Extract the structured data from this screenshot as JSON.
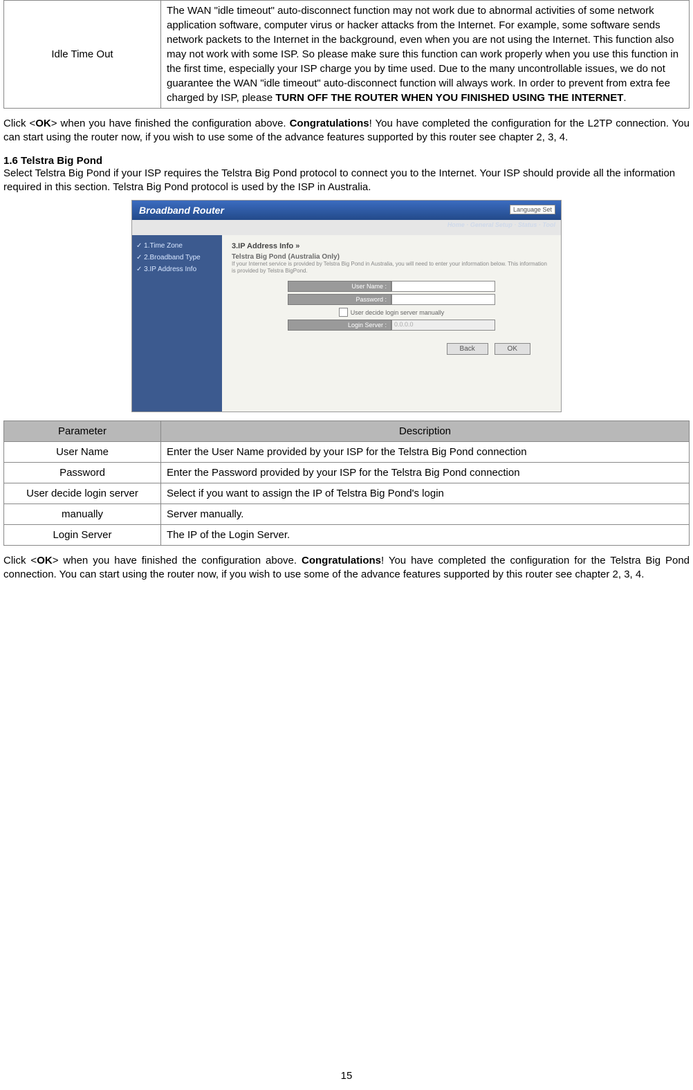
{
  "top_table": {
    "param": "Idle Time Out",
    "desc_main": "The WAN \"idle timeout\" auto-disconnect function may not work due to abnormal activities of some network application software, computer virus or hacker attacks from the Internet. For example, some software sends network packets to the Internet in the background, even when you are not using the Internet. This function also may not work with some ISP. So please make sure this function can work properly when you use this function in the first time, especially your ISP charge you by time used. Due to the many uncontrollable issues, we do not guarantee the WAN \"idle timeout\" auto-disconnect function will always work. In order to prevent from extra fee charged by ISP, please ",
    "desc_bold": "TURN OFF THE ROUTER WHEN YOU FINISHED USING THE INTERNET",
    "desc_end": "."
  },
  "para1": {
    "pre": "Click <",
    "ok": "OK",
    "mid1": "> when you have finished the configuration above. ",
    "congrats": "Congratulations",
    "rest": "! You have completed the configuration for the L2TP connection. You can start using the router now, if you wish to use some of the advance features supported by this router see chapter 2, 3, 4."
  },
  "heading": "1.6 Telstra Big Pond",
  "heading_desc": "Select Telstra Big Pond if your ISP requires the Telstra Big Pond protocol to connect you to the Internet. Your ISP should provide all the information required in this section. Telstra Big Pond protocol is used by the ISP in Australia.",
  "screenshot": {
    "title": "Broadband Router",
    "lang": "Language Set",
    "tabs": "Home · General Setup · Status · Tool",
    "side": [
      "✓ 1.Time Zone",
      "✓ 2.Broadband Type",
      "✓ 3.IP Address Info"
    ],
    "panel_h": "3.IP Address Info »",
    "section_h": "Telstra Big Pond (Australia Only)",
    "note": "If your Internet service is provided by Telstra Big Pond in Australia, you will need to enter your information below. This information is provided by Telstra BigPond.",
    "lbl_user": "User Name :",
    "lbl_pass": "Password :",
    "chk_label": "User decide login server manually",
    "lbl_login": "Login Server :",
    "login_value": "0.0.0.0",
    "btn_back": "Back",
    "btn_ok": "OK"
  },
  "param_table": {
    "h_param": "Parameter",
    "h_desc": "Description",
    "rows": [
      {
        "p": "User Name",
        "d": "Enter the User Name provided by your ISP for the Telstra Big Pond connection"
      },
      {
        "p": "Password",
        "d": "Enter the Password provided by your ISP for the Telstra Big Pond connection"
      },
      {
        "p": "User decide login server",
        "d": "Select if you want to assign the IP of Telstra Big Pond's login"
      },
      {
        "p": "manually",
        "d": "Server manually."
      },
      {
        "p": "Login Server",
        "d": "The IP of the Login Server."
      }
    ]
  },
  "para2": {
    "pre": "Click <",
    "ok": "OK",
    "mid1": "> when you have finished the configuration above. ",
    "congrats": "Congratulations",
    "rest": "! You have completed the configuration for the Telstra Big Pond connection. You can start using the router now, if you wish to use some of the advance features supported by this router see chapter 2, 3, 4."
  },
  "page_number": "15"
}
